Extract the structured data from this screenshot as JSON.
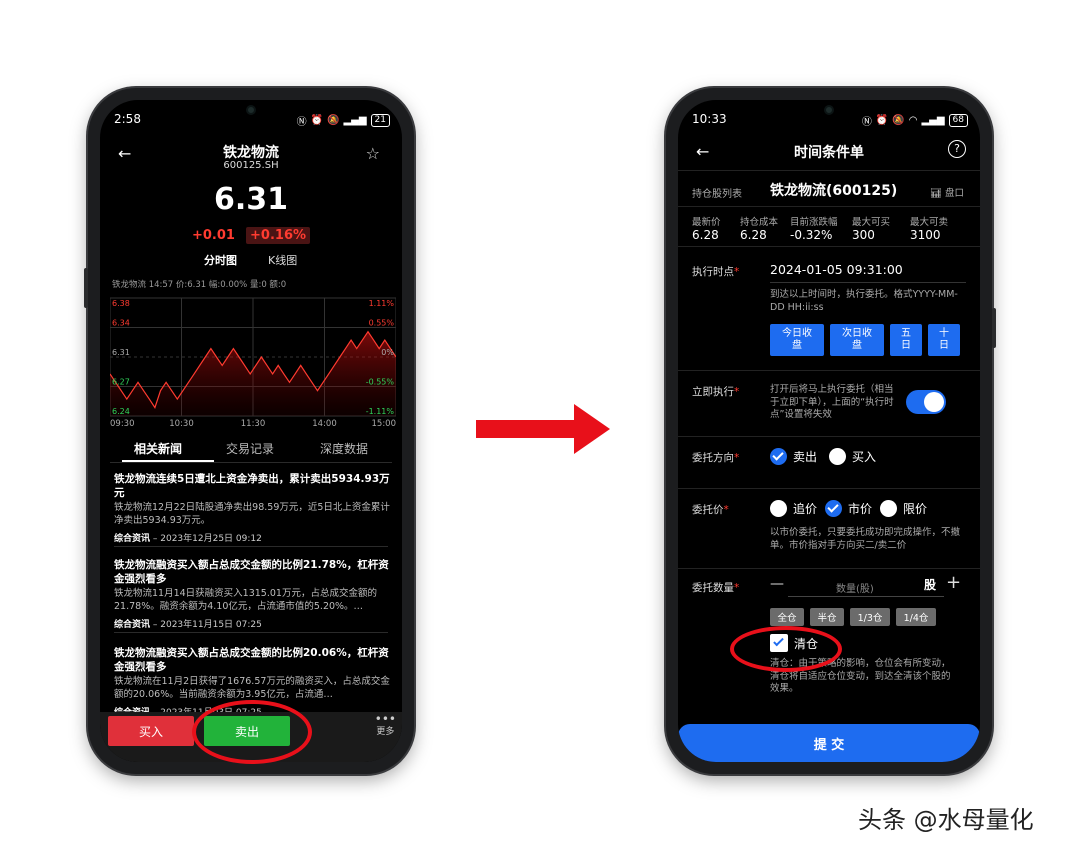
{
  "left": {
    "status": {
      "time": "2:58",
      "battery": "21"
    },
    "header": {
      "title": "铁龙物流",
      "code": "600125.SH"
    },
    "quote": {
      "price": "6.31",
      "change": "+0.01",
      "change_pct": "+0.16%"
    },
    "chart_tabs": [
      "分时图",
      "K线图"
    ],
    "chart_info": "铁龙物流 14:57 价:6.31 幅:0.00% 量:0 额:0",
    "chart_data": {
      "type": "line",
      "x": [
        "09:30",
        "10:30",
        "11:30",
        "14:00",
        "15:00"
      ],
      "y_left_ticks": [
        "6.38",
        "6.34",
        "6.31",
        "6.27",
        "6.24"
      ],
      "y_right_ticks": [
        "1.11%",
        "0.55%",
        "0%",
        "-0.55%",
        "-1.11%"
      ],
      "ylim": [
        6.24,
        6.38
      ],
      "values": [
        6.29,
        6.28,
        6.27,
        6.26,
        6.27,
        6.28,
        6.27,
        6.26,
        6.25,
        6.27,
        6.28,
        6.27,
        6.26,
        6.27,
        6.28,
        6.29,
        6.3,
        6.31,
        6.32,
        6.31,
        6.3,
        6.31,
        6.32,
        6.31,
        6.3,
        6.29,
        6.3,
        6.31,
        6.3,
        6.29,
        6.3,
        6.29,
        6.28,
        6.29,
        6.3,
        6.29,
        6.28,
        6.27,
        6.28,
        6.29,
        6.3,
        6.31,
        6.32,
        6.33,
        6.32,
        6.33,
        6.34,
        6.33,
        6.32,
        6.33,
        6.32,
        6.31
      ]
    },
    "news_tabs": [
      "相关新闻",
      "交易记录",
      "深度数据"
    ],
    "news": [
      {
        "title": "铁龙物流连续5日遭北上资金净卖出，累计卖出5934.93万元",
        "body": "铁龙物流12月22日陆股通净卖出98.59万元，近5日北上资金累计净卖出5934.93万元。",
        "source": "综合资讯",
        "date": "– 2023年12月25日 09:12"
      },
      {
        "title": "铁龙物流融资买入额占总成交金额的比例21.78%，杠杆资金强烈看多",
        "body": "铁龙物流11月14日获融资买入1315.01万元，占总成交金额的21.78%。融资余额为4.10亿元，占流通市值的5.20%。…",
        "source": "综合资讯",
        "date": "– 2023年11月15日 07:25"
      },
      {
        "title": "铁龙物流融资买入额占总成交金额的比例20.06%，杠杆资金强烈看多",
        "body": "铁龙物流在11月2日获得了1676.57万元的融资买入，占总成交金额的20.06%。当前融资余额为3.95亿元，占流通…",
        "source": "综合资讯",
        "date": "– 2023年11月03日 07:25"
      }
    ],
    "bottom": {
      "buy": "买入",
      "sell": "卖出",
      "more": "更多"
    }
  },
  "right": {
    "status": {
      "time": "10:33",
      "battery": "68"
    },
    "header": {
      "title": "时间条件单",
      "help": "?"
    },
    "holdings_label": "持仓股列表",
    "stock_name": "铁龙物流(600125)",
    "panel_label": "盘口",
    "stats": [
      {
        "label": "最新价",
        "value": "6.28"
      },
      {
        "label": "持仓成本",
        "value": "6.28"
      },
      {
        "label": "目前涨跌幅",
        "value": "-0.32%"
      },
      {
        "label": "最大可买",
        "value": "300"
      },
      {
        "label": "最大可卖",
        "value": "3100"
      }
    ],
    "exec_time": {
      "label": "执行时点",
      "value": "2024-01-05 09:31:00",
      "hint": "到达以上时间时，执行委托。格式YYYY-MM-DD HH:ii:ss",
      "buttons": [
        "今日收盘",
        "次日收盘",
        "五日",
        "十日"
      ]
    },
    "immediate": {
      "label": "立即执行",
      "hint": "打开后将马上执行委托（相当于立即下单），上面的“执行时点”设置将失效"
    },
    "direction": {
      "label": "委托方向",
      "options": [
        "卖出",
        "买入"
      ]
    },
    "price": {
      "label": "委托价",
      "options": [
        "追价",
        "市价",
        "限价"
      ],
      "hint": "以市价委托，只要委托成功即完成操作，不撤单。市价指对手方向买二/卖二价"
    },
    "quantity": {
      "label": "委托数量",
      "minus": "—",
      "placeholder": "数量(股)",
      "unit": "股",
      "plus": "+",
      "quick": [
        "全仓",
        "半仓",
        "1/3仓",
        "1/4仓"
      ],
      "clear_label": "清仓",
      "clear_hint": "清仓：由于策略的影响，仓位会有所变动，清仓将自适应仓位变动，到达全清该个股的效果。"
    },
    "submit": "提 交"
  },
  "watermark": "头条 @水母量化",
  "colors": {
    "accent": "#1e6cf0",
    "up": "#ff3b30",
    "down": "#2fd35a",
    "annotation": "#e8101a"
  }
}
